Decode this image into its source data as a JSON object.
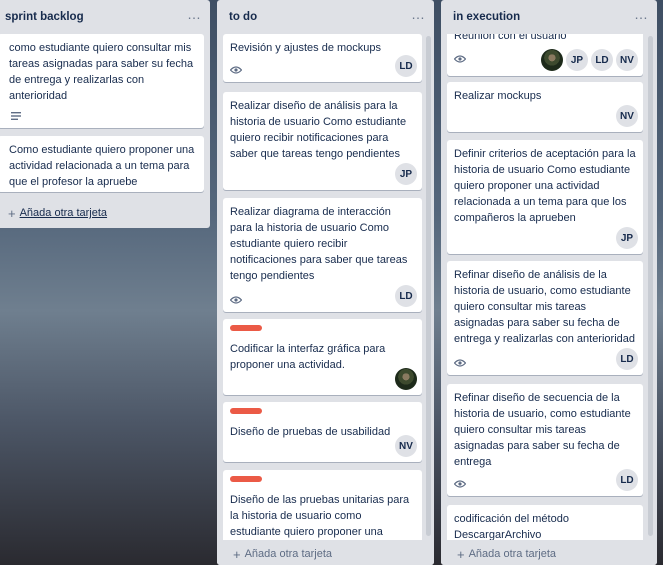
{
  "colors": {
    "list_bg": "#dfe1e6",
    "card_bg": "#ffffff",
    "label_red": "#eb5a46",
    "text": "#172b4d",
    "muted": "#5e6c84"
  },
  "more_icon": "…",
  "lists": [
    {
      "title": "sprint backlog",
      "add_card": "Añada otra tarjeta",
      "cards": [
        {
          "title": "como estudiante quiero consultar mis tareas asignadas para saber su fecha de entrega y realizarlas con anterioridad",
          "badge": "description-icon"
        },
        {
          "title": "Como estudiante quiero proponer una actividad relacionada a un tema para que el profesor la apruebe"
        }
      ]
    },
    {
      "title": "to do",
      "add_card": "Añada otra tarjeta",
      "cards": [
        {
          "title": "Revisión y ajustes de mockups",
          "badge": "eye-icon",
          "members": [
            "LD"
          ]
        },
        {
          "title": "Realizar diseño de análisis para la historia de usuario Como estudiante quiero recibir notificaciones para saber que tareas tengo pendientes",
          "members": [
            "JP"
          ]
        },
        {
          "title": "Realizar diagrama de interacción para la historia de usuario Como estudiante quiero recibir notificaciones para saber que tareas tengo pendientes",
          "badge": "eye-icon",
          "members": [
            "LD"
          ]
        },
        {
          "title": "Codificar la interfaz gráfica para proponer una actividad.",
          "label": "red",
          "members": [
            "photo"
          ]
        },
        {
          "title": "Diseño de pruebas de usabilidad",
          "label": "red",
          "members": [
            "NV"
          ]
        },
        {
          "title": "Diseño de las pruebas unitarias para la historia de usuario como estudiante quiero proponer una actividad relacionada a un tema para que el",
          "label": "red"
        }
      ]
    },
    {
      "title": "in execution",
      "add_card": "Añada otra tarjeta",
      "cards": [
        {
          "title": "Reunión con el usuario",
          "badge": "eye-icon",
          "members": [
            "photo",
            "JP",
            "LD",
            "NV"
          ]
        },
        {
          "title": "Realizar mockups",
          "members": [
            "NV"
          ]
        },
        {
          "title": "Definir criterios de aceptación para la historia de usuario Como estudiante quiero proponer una actividad relacionada a un tema para que los compañeros la aprueben",
          "members": [
            "JP"
          ]
        },
        {
          "title": "Refinar diseño de análisis de la historia de usuario, como estudiante quiero consultar mis tareas asignadas para saber su fecha de entrega y realizarlas con anterioridad",
          "badge": "eye-icon",
          "members": [
            "LD"
          ]
        },
        {
          "title": "Refinar diseño de secuencia de la historia de usuario, como estudiante quiero consultar mis tareas asignadas para saber su fecha de entrega",
          "badge": "eye-icon",
          "members": [
            "LD"
          ]
        },
        {
          "title": "codificación del método DescargarArchivo"
        }
      ]
    }
  ]
}
